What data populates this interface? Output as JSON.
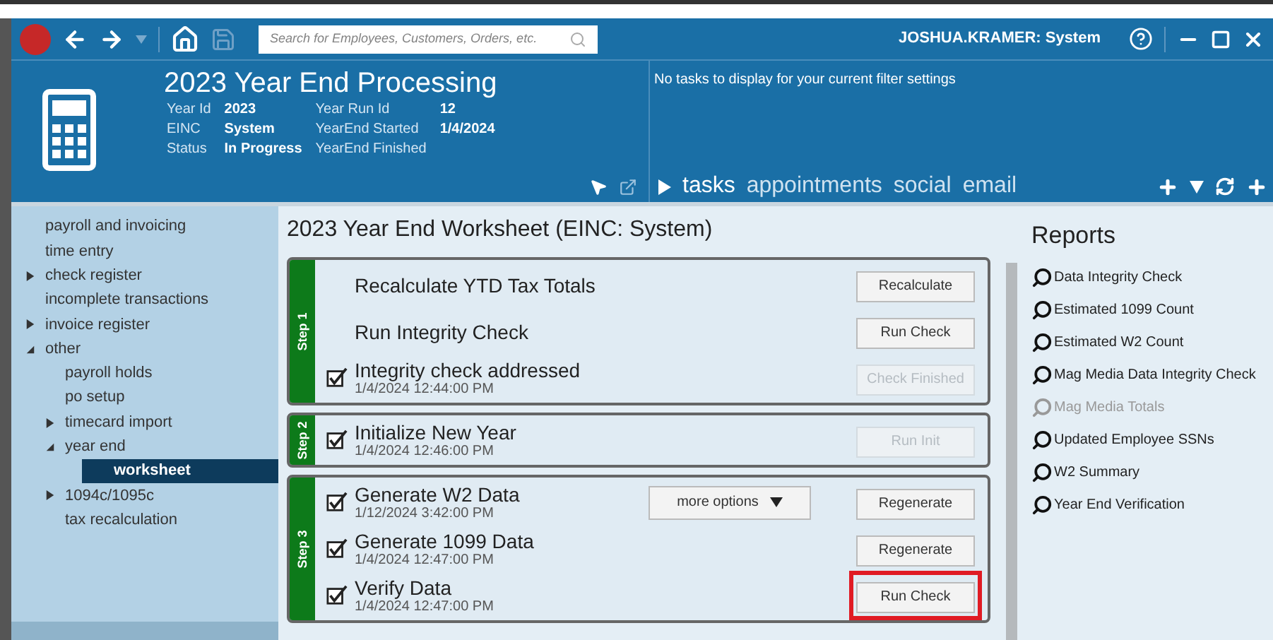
{
  "search": {
    "placeholder": "Search for Employees, Customers, Orders, etc."
  },
  "user": "JOSHUA.KRAMER: System",
  "header": {
    "title": "2023 Year End Processing",
    "fields": [
      {
        "label": "Year Id",
        "value": "2023"
      },
      {
        "label": "Year Run Id",
        "value": "12"
      },
      {
        "label": "EINC",
        "value": "System"
      },
      {
        "label": "YearEnd Started",
        "value": "1/4/2024"
      },
      {
        "label": "Status",
        "value": "In Progress"
      },
      {
        "label": "YearEnd Finished"
      }
    ]
  },
  "tasks_panel": {
    "message": "No tasks to display for your current filter settings",
    "tabs": [
      {
        "label": "tasks",
        "selected": true
      },
      {
        "label": "appointments",
        "selected": false
      },
      {
        "label": "social",
        "selected": false
      },
      {
        "label": "email",
        "selected": false
      }
    ]
  },
  "sidebar": {
    "items": [
      {
        "label": "payroll and invoicing",
        "selected": false
      },
      {
        "label": "time entry",
        "selected": false
      },
      {
        "label": "check register",
        "expanded": false,
        "selected": false
      },
      {
        "label": "incomplete transactions",
        "selected": false
      },
      {
        "label": "invoice register",
        "expanded": false,
        "selected": false
      },
      {
        "label": "other",
        "expanded": true,
        "selected": false,
        "children": [
          {
            "label": "payroll holds",
            "selected": false
          },
          {
            "label": "po setup",
            "selected": false
          },
          {
            "label": "timecard import",
            "expanded": false,
            "selected": false
          },
          {
            "label": "year end",
            "expanded": true,
            "selected": false,
            "children": [
              {
                "label": "worksheet",
                "selected": true
              }
            ]
          },
          {
            "label": "1094c/1095c",
            "expanded": false,
            "selected": false
          },
          {
            "label": "tax recalculation",
            "selected": false
          }
        ]
      }
    ]
  },
  "worksheet": {
    "title": "2023 Year End Worksheet (EINC: System)",
    "steps": [
      {
        "label": "Step 1",
        "tasks": [
          {
            "name": "Recalculate YTD Tax Totals",
            "checked": false,
            "button": {
              "label": "Recalculate",
              "disabled": false,
              "highlighted": false
            }
          },
          {
            "name": "Run Integrity Check",
            "checked": false,
            "button": {
              "label": "Run Check",
              "disabled": false,
              "highlighted": false
            }
          },
          {
            "name": "Integrity check addressed",
            "checked": true,
            "time": "1/4/2024 12:44:00 PM",
            "button": {
              "label": "Check Finished",
              "disabled": true,
              "highlighted": false
            }
          }
        ]
      },
      {
        "label": "Step 2",
        "tasks": [
          {
            "name": "Initialize New Year",
            "checked": true,
            "time": "1/4/2024 12:46:00 PM",
            "button": {
              "label": "Run Init",
              "disabled": true,
              "highlighted": false
            }
          }
        ]
      },
      {
        "label": "Step 3",
        "tasks": [
          {
            "name": "Generate W2 Data",
            "checked": true,
            "time": "1/12/2024 3:42:00 PM",
            "extra": "more options",
            "button": {
              "label": "Regenerate",
              "disabled": false,
              "highlighted": false
            }
          },
          {
            "name": "Generate 1099 Data",
            "checked": true,
            "time": "1/4/2024 12:47:00 PM",
            "button": {
              "label": "Regenerate",
              "disabled": false,
              "highlighted": false
            }
          },
          {
            "name": "Verify Data",
            "checked": true,
            "time": "1/4/2024 12:47:00 PM",
            "button": {
              "label": "Run Check",
              "disabled": false,
              "highlighted": true
            }
          }
        ]
      }
    ]
  },
  "reports": {
    "title": "Reports",
    "items": [
      {
        "label": "Data Integrity Check",
        "disabled": false
      },
      {
        "label": "Estimated 1099 Count",
        "disabled": false
      },
      {
        "label": "Estimated W2 Count",
        "disabled": false
      },
      {
        "label": "Mag Media Data Integrity Check",
        "disabled": false
      },
      {
        "label": "Mag Media Totals",
        "disabled": true
      },
      {
        "label": "Updated Employee SSNs",
        "disabled": false
      },
      {
        "label": "W2 Summary",
        "disabled": false
      },
      {
        "label": "Year End Verification",
        "disabled": false
      }
    ]
  }
}
